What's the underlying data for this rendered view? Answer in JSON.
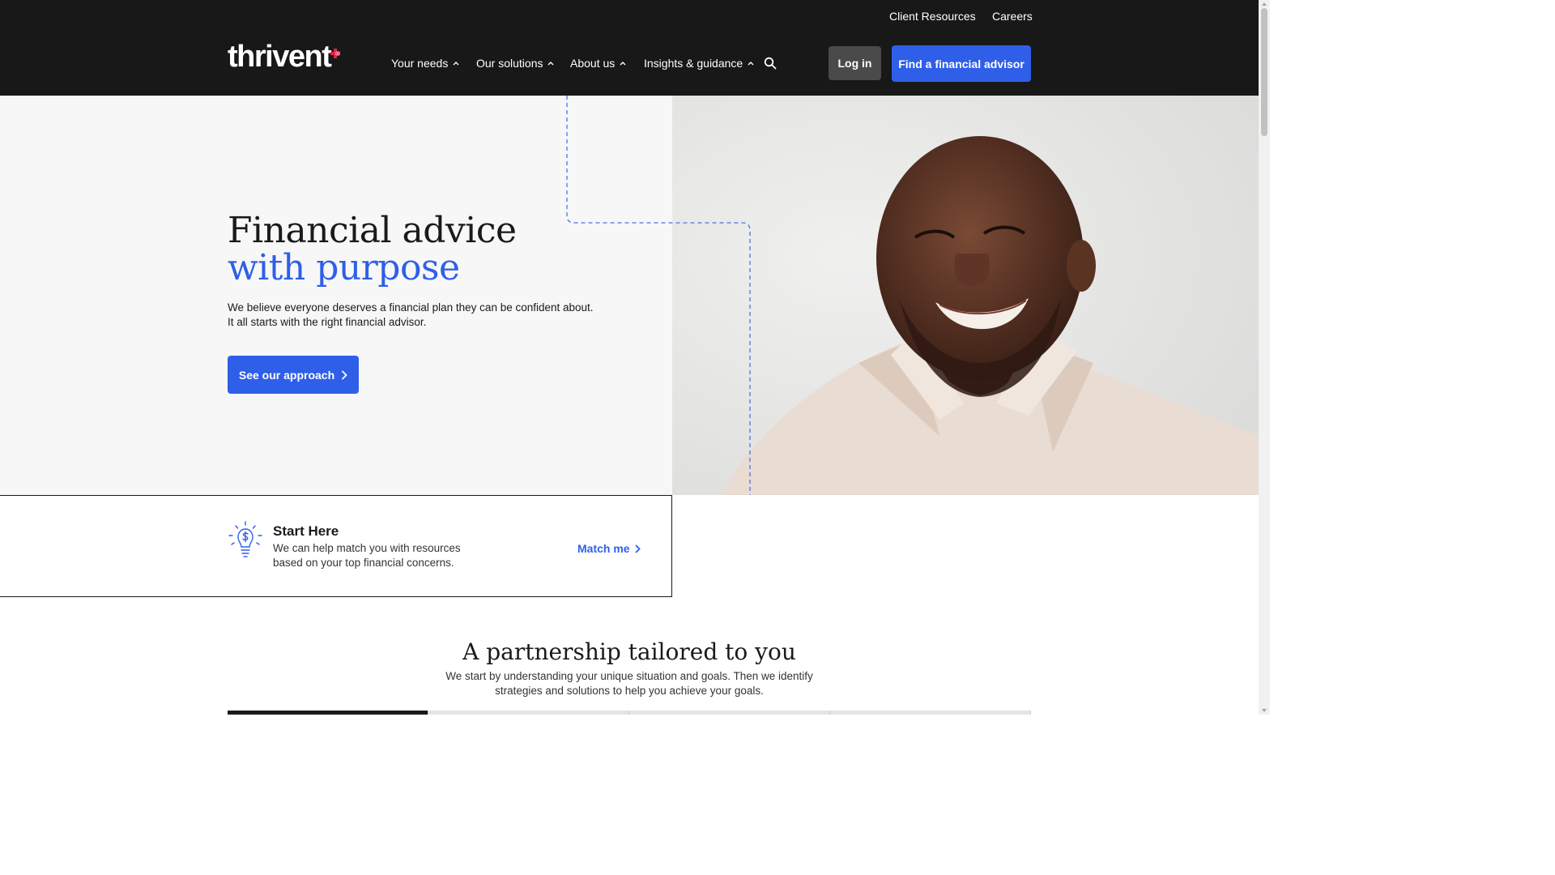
{
  "header": {
    "utility_links": [
      "Client Resources",
      "Careers"
    ],
    "logo_text": "thrivent",
    "logo_mark": "®",
    "nav": [
      "Your needs",
      "Our solutions",
      "About us",
      "Insights & guidance"
    ],
    "search_icon": "search-icon",
    "login_label": "Log in",
    "advisor_label": "Find a financial advisor"
  },
  "hero": {
    "title_line1": "Financial advice",
    "title_line2": "with purpose",
    "desc_line1": "We believe everyone deserves a financial plan they can be confident about.",
    "desc_line2": "It all starts with the right financial advisor.",
    "cta_label": "See our approach"
  },
  "start_here": {
    "icon": "lightbulb-dollar-icon",
    "title": "Start Here",
    "desc": "We can help match you with resources based on your top financial concerns.",
    "link_label": "Match me"
  },
  "partnership": {
    "title": "A partnership tailored to you",
    "desc": "We start by understanding your unique situation and goals. Then we identify strategies and solutions to help you achieve your goals.",
    "tabs_active_index": 0
  },
  "colors": {
    "header_bg": "#181818",
    "accent_blue": "#2f5fe8",
    "login_bg": "#4a4a4a",
    "brand_red": "#e0244b"
  }
}
